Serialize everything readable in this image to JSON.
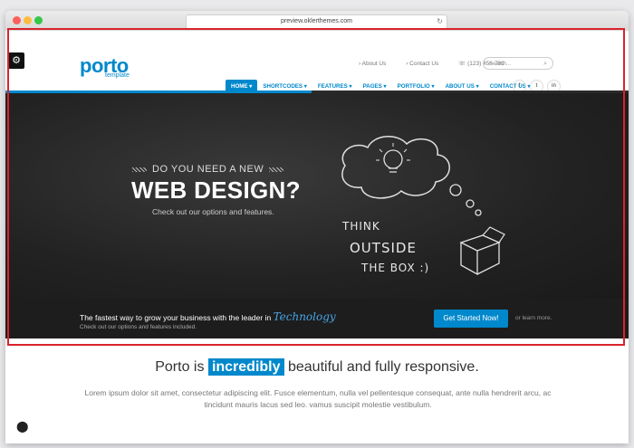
{
  "browser": {
    "url": "preview.oklerthemes.com",
    "reload_icon": "↻"
  },
  "header": {
    "logo": "porto",
    "logo_sub": "template",
    "top_links": [
      "About Us",
      "Contact Us",
      "(123) 456-789"
    ],
    "search_placeholder": "Search...",
    "nav": [
      "HOME ▾",
      "SHORTCODES ▾",
      "FEATURES ▾",
      "PAGES ▾",
      "PORTFOLIO ▾",
      "ABOUT US ▾",
      "CONTACT US ▾"
    ],
    "social": [
      "f",
      "t",
      "in"
    ],
    "accent_color": "#0088cc"
  },
  "hero": {
    "small_title": "DO YOU NEED A NEW",
    "big_title": "WEB DESIGN?",
    "subtitle": "Check out our options and features.",
    "chalk_text": [
      "THINK",
      "OUTSIDE",
      "THE BOX :)"
    ]
  },
  "bar": {
    "line1": "The fastest way to grow your business with the leader in",
    "tech": "Technology",
    "line2": "Check out our options and features included.",
    "button": "Get Started Now!",
    "or_learn": "or learn more."
  },
  "content": {
    "headline_pre": "Porto is",
    "headline_highlight": "incredibly",
    "headline_post": "beautiful and fully responsive.",
    "lorem": "Lorem ipsum dolor sit amet, consectetur adipiscing elit. Fusce elementum, nulla vel pellentesque consequat, ante nulla hendrerit arcu, ac tincidunt mauris lacus sed leo. vamus suscipit molestie vestibulum."
  }
}
